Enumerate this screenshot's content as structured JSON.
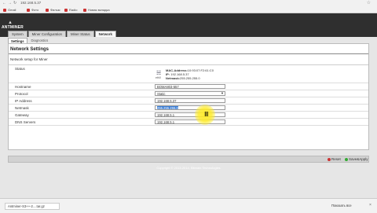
{
  "browser": {
    "url": "192.168.5.37",
    "bookmarks": [
      "Gmail",
      "Фото",
      "Фильм",
      "Radio",
      "Новая вкладка"
    ]
  },
  "brand": {
    "logo_text": "ANTMINER"
  },
  "tabs": [
    {
      "label": "System",
      "active": false
    },
    {
      "label": "Miner Configuration",
      "active": false
    },
    {
      "label": "Miner Status",
      "active": false
    },
    {
      "label": "Network",
      "active": true
    }
  ],
  "subtabs": [
    {
      "label": "Settings",
      "active": true
    },
    {
      "label": "Diagnostics",
      "active": false
    }
  ],
  "panel": {
    "title": "Network Settings",
    "description": "Network setup for Miner"
  },
  "status": {
    "label": "Status",
    "icon_caption": "eth0",
    "mac_label": "MAC-Address:",
    "mac_value": "10:93:07:F2:61:C0",
    "ip_label": "IP:",
    "ip_value": "192.168.5.37",
    "netmask_label": "Netmask:",
    "netmask_value": "255.255.255.0"
  },
  "fields": [
    {
      "label": "Hostname",
      "value": "BOMA803-557",
      "type": "text"
    },
    {
      "label": "Protocol",
      "value": "Static",
      "type": "select"
    },
    {
      "label": "IP Address",
      "value": "192.168.5.37",
      "type": "text"
    },
    {
      "label": "Netmask",
      "value": "255.255.255.0",
      "type": "text",
      "selected": true
    },
    {
      "label": "Gateway",
      "value": "192.168.5.1",
      "type": "text"
    },
    {
      "label": "DNS Servers",
      "value": "192.168.5.1",
      "type": "text"
    }
  ],
  "buttons": {
    "reset": "Reset",
    "save_apply": "Save&Apply"
  },
  "footer": {
    "copyright": "Copyright © 2013-2014, Bitmain Technologies"
  },
  "downloads": {
    "file": "Antminer-S3++-2....tar.gz",
    "show_all": "Показать все"
  }
}
